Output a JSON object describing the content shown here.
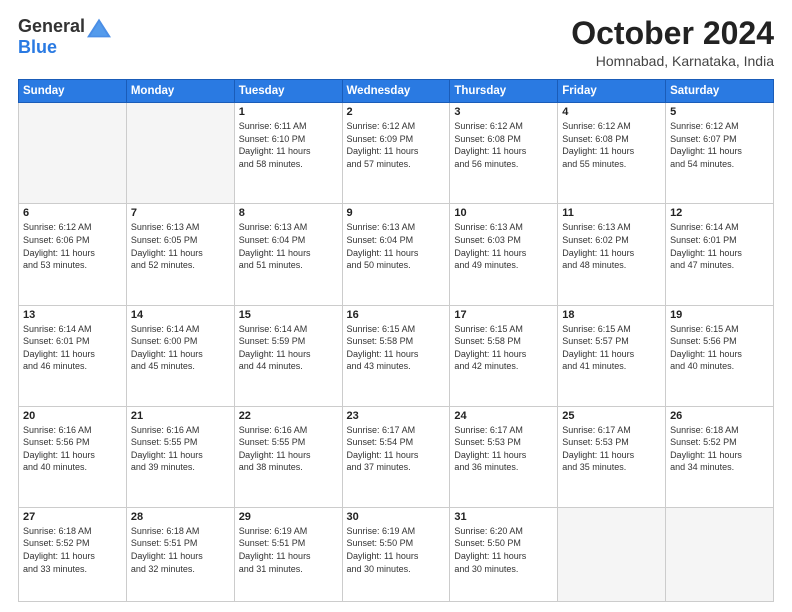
{
  "header": {
    "logo_line1": "General",
    "logo_line2": "Blue",
    "month_title": "October 2024",
    "location": "Homnabad, Karnataka, India"
  },
  "weekdays": [
    "Sunday",
    "Monday",
    "Tuesday",
    "Wednesday",
    "Thursday",
    "Friday",
    "Saturday"
  ],
  "weeks": [
    [
      {
        "day": "",
        "info": ""
      },
      {
        "day": "",
        "info": ""
      },
      {
        "day": "1",
        "info": "Sunrise: 6:11 AM\nSunset: 6:10 PM\nDaylight: 11 hours\nand 58 minutes."
      },
      {
        "day": "2",
        "info": "Sunrise: 6:12 AM\nSunset: 6:09 PM\nDaylight: 11 hours\nand 57 minutes."
      },
      {
        "day": "3",
        "info": "Sunrise: 6:12 AM\nSunset: 6:08 PM\nDaylight: 11 hours\nand 56 minutes."
      },
      {
        "day": "4",
        "info": "Sunrise: 6:12 AM\nSunset: 6:08 PM\nDaylight: 11 hours\nand 55 minutes."
      },
      {
        "day": "5",
        "info": "Sunrise: 6:12 AM\nSunset: 6:07 PM\nDaylight: 11 hours\nand 54 minutes."
      }
    ],
    [
      {
        "day": "6",
        "info": "Sunrise: 6:12 AM\nSunset: 6:06 PM\nDaylight: 11 hours\nand 53 minutes."
      },
      {
        "day": "7",
        "info": "Sunrise: 6:13 AM\nSunset: 6:05 PM\nDaylight: 11 hours\nand 52 minutes."
      },
      {
        "day": "8",
        "info": "Sunrise: 6:13 AM\nSunset: 6:04 PM\nDaylight: 11 hours\nand 51 minutes."
      },
      {
        "day": "9",
        "info": "Sunrise: 6:13 AM\nSunset: 6:04 PM\nDaylight: 11 hours\nand 50 minutes."
      },
      {
        "day": "10",
        "info": "Sunrise: 6:13 AM\nSunset: 6:03 PM\nDaylight: 11 hours\nand 49 minutes."
      },
      {
        "day": "11",
        "info": "Sunrise: 6:13 AM\nSunset: 6:02 PM\nDaylight: 11 hours\nand 48 minutes."
      },
      {
        "day": "12",
        "info": "Sunrise: 6:14 AM\nSunset: 6:01 PM\nDaylight: 11 hours\nand 47 minutes."
      }
    ],
    [
      {
        "day": "13",
        "info": "Sunrise: 6:14 AM\nSunset: 6:01 PM\nDaylight: 11 hours\nand 46 minutes."
      },
      {
        "day": "14",
        "info": "Sunrise: 6:14 AM\nSunset: 6:00 PM\nDaylight: 11 hours\nand 45 minutes."
      },
      {
        "day": "15",
        "info": "Sunrise: 6:14 AM\nSunset: 5:59 PM\nDaylight: 11 hours\nand 44 minutes."
      },
      {
        "day": "16",
        "info": "Sunrise: 6:15 AM\nSunset: 5:58 PM\nDaylight: 11 hours\nand 43 minutes."
      },
      {
        "day": "17",
        "info": "Sunrise: 6:15 AM\nSunset: 5:58 PM\nDaylight: 11 hours\nand 42 minutes."
      },
      {
        "day": "18",
        "info": "Sunrise: 6:15 AM\nSunset: 5:57 PM\nDaylight: 11 hours\nand 41 minutes."
      },
      {
        "day": "19",
        "info": "Sunrise: 6:15 AM\nSunset: 5:56 PM\nDaylight: 11 hours\nand 40 minutes."
      }
    ],
    [
      {
        "day": "20",
        "info": "Sunrise: 6:16 AM\nSunset: 5:56 PM\nDaylight: 11 hours\nand 40 minutes."
      },
      {
        "day": "21",
        "info": "Sunrise: 6:16 AM\nSunset: 5:55 PM\nDaylight: 11 hours\nand 39 minutes."
      },
      {
        "day": "22",
        "info": "Sunrise: 6:16 AM\nSunset: 5:55 PM\nDaylight: 11 hours\nand 38 minutes."
      },
      {
        "day": "23",
        "info": "Sunrise: 6:17 AM\nSunset: 5:54 PM\nDaylight: 11 hours\nand 37 minutes."
      },
      {
        "day": "24",
        "info": "Sunrise: 6:17 AM\nSunset: 5:53 PM\nDaylight: 11 hours\nand 36 minutes."
      },
      {
        "day": "25",
        "info": "Sunrise: 6:17 AM\nSunset: 5:53 PM\nDaylight: 11 hours\nand 35 minutes."
      },
      {
        "day": "26",
        "info": "Sunrise: 6:18 AM\nSunset: 5:52 PM\nDaylight: 11 hours\nand 34 minutes."
      }
    ],
    [
      {
        "day": "27",
        "info": "Sunrise: 6:18 AM\nSunset: 5:52 PM\nDaylight: 11 hours\nand 33 minutes."
      },
      {
        "day": "28",
        "info": "Sunrise: 6:18 AM\nSunset: 5:51 PM\nDaylight: 11 hours\nand 32 minutes."
      },
      {
        "day": "29",
        "info": "Sunrise: 6:19 AM\nSunset: 5:51 PM\nDaylight: 11 hours\nand 31 minutes."
      },
      {
        "day": "30",
        "info": "Sunrise: 6:19 AM\nSunset: 5:50 PM\nDaylight: 11 hours\nand 30 minutes."
      },
      {
        "day": "31",
        "info": "Sunrise: 6:20 AM\nSunset: 5:50 PM\nDaylight: 11 hours\nand 30 minutes."
      },
      {
        "day": "",
        "info": ""
      },
      {
        "day": "",
        "info": ""
      }
    ]
  ]
}
